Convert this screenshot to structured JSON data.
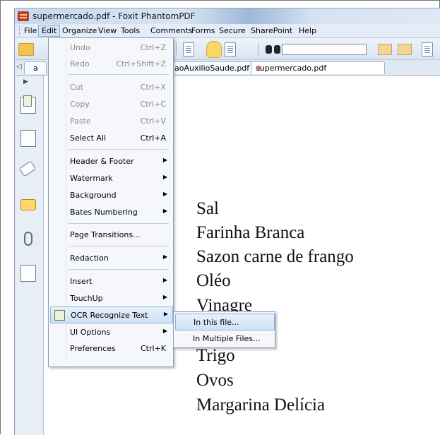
{
  "window": {
    "title": "supermercado.pdf - Foxit PhantomPDF"
  },
  "menubar": {
    "items": [
      "File",
      "Edit",
      "Organize",
      "View",
      "Tools",
      "Comments",
      "Forms",
      "Secure",
      "SharePoint",
      "Help"
    ],
    "active": "Edit"
  },
  "tabs": {
    "first_partial": "a",
    "second": "aoAuxilioSaude.pdf",
    "third": "supermercado.pdf",
    "close_glyph": "⊗"
  },
  "edit_menu": {
    "undo": {
      "label": "Undo",
      "shortcut": "Ctrl+Z"
    },
    "redo": {
      "label": "Redo",
      "shortcut": "Ctrl+Shift+Z"
    },
    "cut": {
      "label": "Cut",
      "shortcut": "Ctrl+X"
    },
    "copy": {
      "label": "Copy",
      "shortcut": "Ctrl+C"
    },
    "paste": {
      "label": "Paste",
      "shortcut": "Ctrl+V"
    },
    "select_all": {
      "label": "Select All",
      "shortcut": "Ctrl+A"
    },
    "header_footer": "Header & Footer",
    "watermark": "Watermark",
    "background": "Background",
    "bates": "Bates Numbering",
    "page_transitions": "Page Transitions...",
    "redaction": "Redaction",
    "insert": "Insert",
    "touchup": "TouchUp",
    "ocr": "OCR Recognize Text",
    "ui_options": "UI Options",
    "preferences": {
      "label": "Preferences",
      "shortcut": "Ctrl+K"
    }
  },
  "ocr_submenu": {
    "in_this_file": "In this file...",
    "in_multiple_files": "In Multiple Files..."
  },
  "document": {
    "lines": [
      "Sal",
      "Farinha Branca",
      "Sazon carne de frango",
      "Oléo",
      "Vinagre",
      "Trigo",
      "Ovos",
      "Margarina Delícia"
    ]
  },
  "colors": {
    "highlight": "#cfe1f6",
    "menu_bg": "#f5f7fb",
    "chrome": "#dfe8f3"
  }
}
